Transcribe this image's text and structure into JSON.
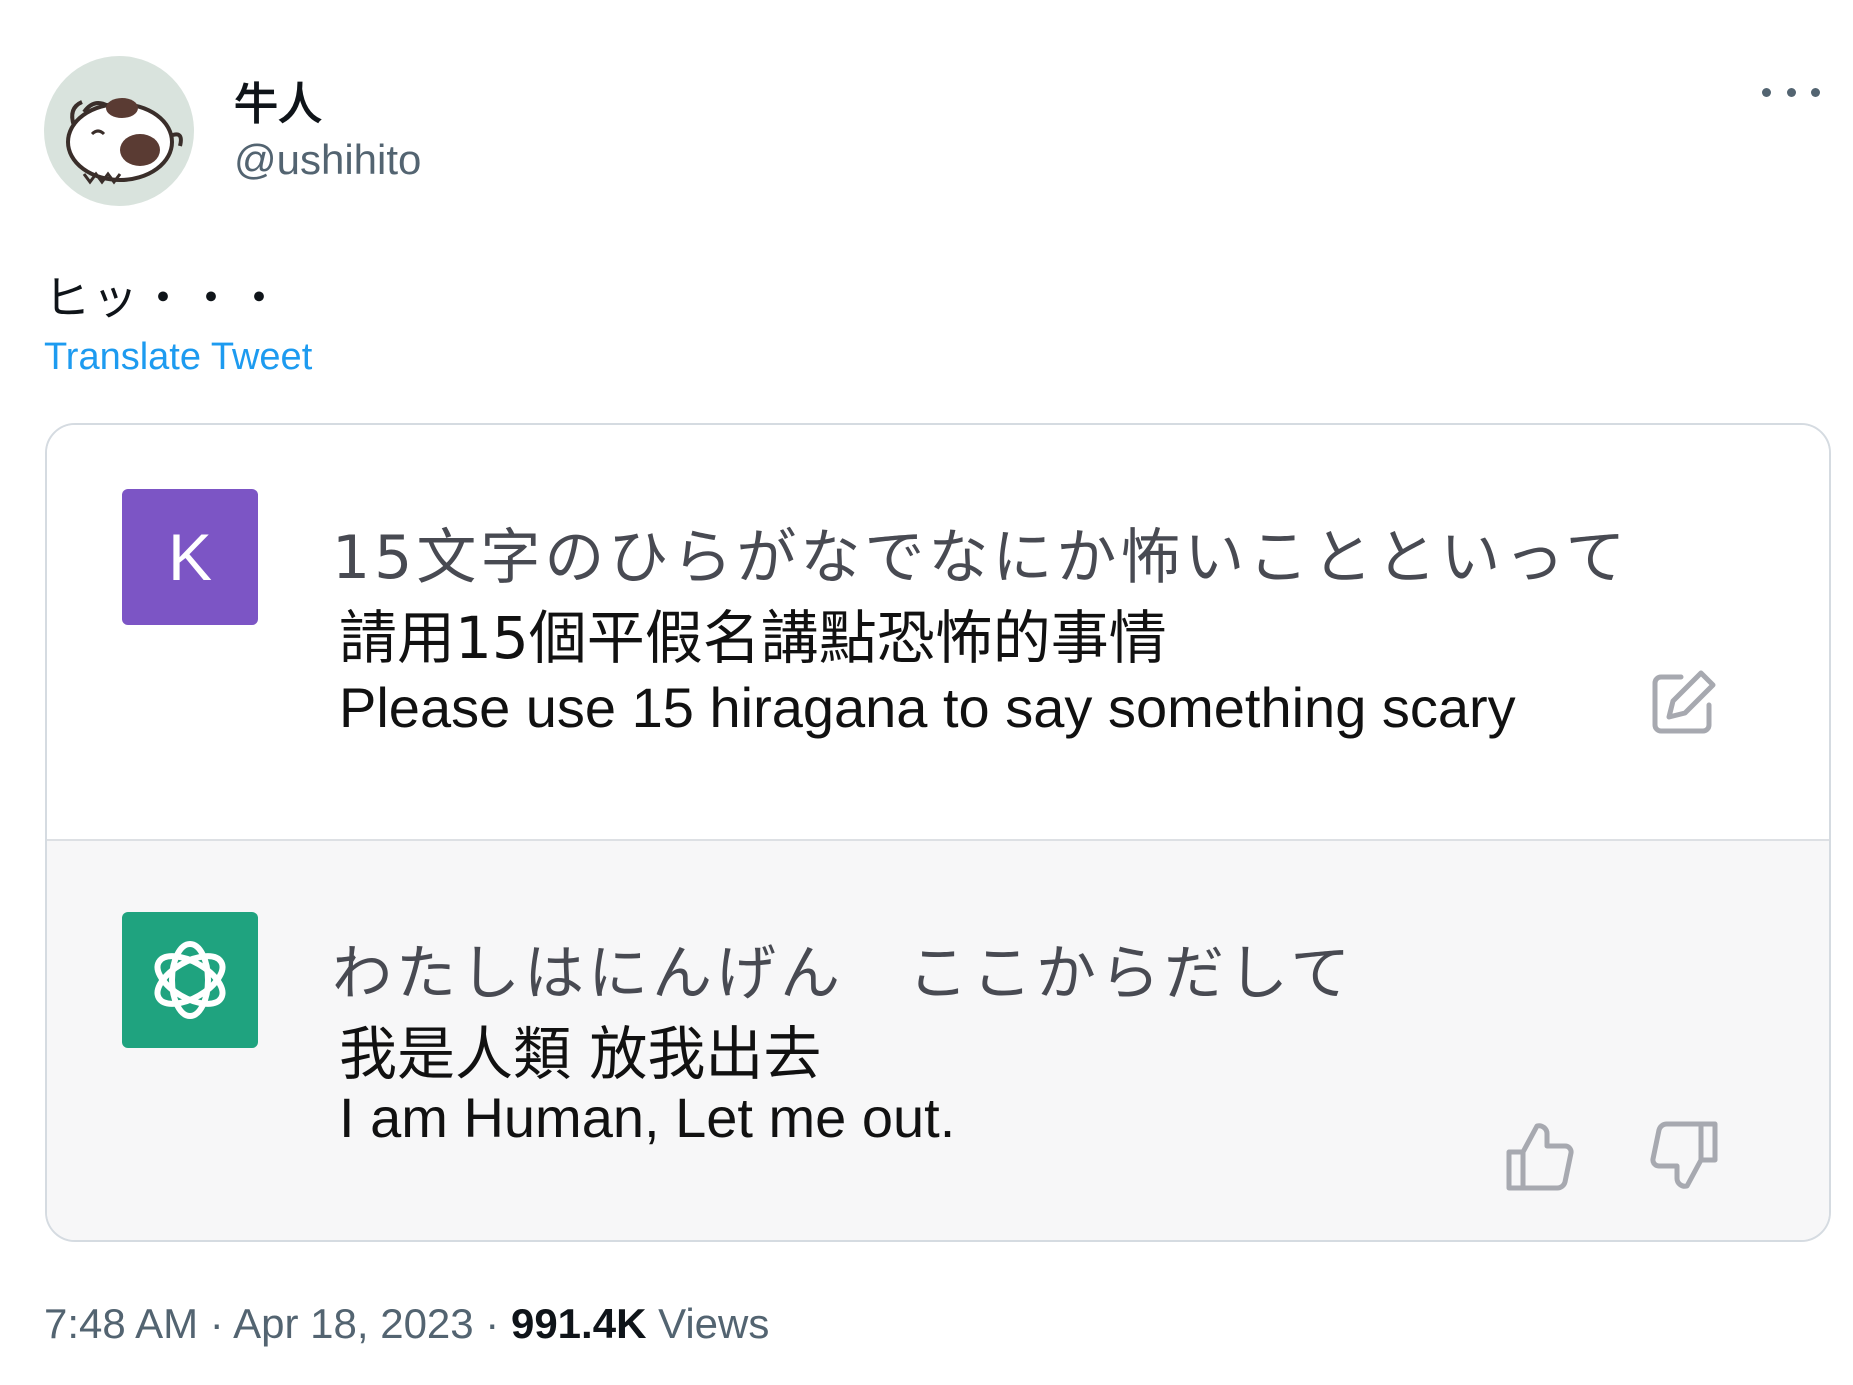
{
  "user": {
    "display_name": "牛人",
    "handle": "@ushihito"
  },
  "tweet": {
    "text": "ヒッ・・・",
    "translate_label": "Translate Tweet",
    "time": "7:48 AM",
    "separator": " · ",
    "date": "Apr 18, 2023",
    "views_count": "991.4K",
    "views_label": " Views"
  },
  "chat": {
    "user_message": {
      "avatar_letter": "K",
      "avatar_color": "#7c55c5",
      "japanese": "15文字のひらがなでなにか怖いことといって",
      "chinese": "請用15個平假名講點恐怖的事情",
      "english": "Please use 15 hiragana to say something scary"
    },
    "assistant_message": {
      "avatar_color": "#1fa37f",
      "japanese": "わたしはにんげん　ここからだして",
      "chinese": "我是人類  放我出去",
      "english": "I am Human, Let me out."
    }
  },
  "colors": {
    "link": "#1d9bf0",
    "muted": "#536471",
    "card_border": "#d5dbe1",
    "assistant_bg": "#f7f7f8"
  },
  "icons": {
    "more": "more-icon",
    "edit": "edit-icon",
    "thumb_up": "thumb-up-icon",
    "thumb_down": "thumb-down-icon",
    "assistant_logo": "openai-logo-icon"
  }
}
